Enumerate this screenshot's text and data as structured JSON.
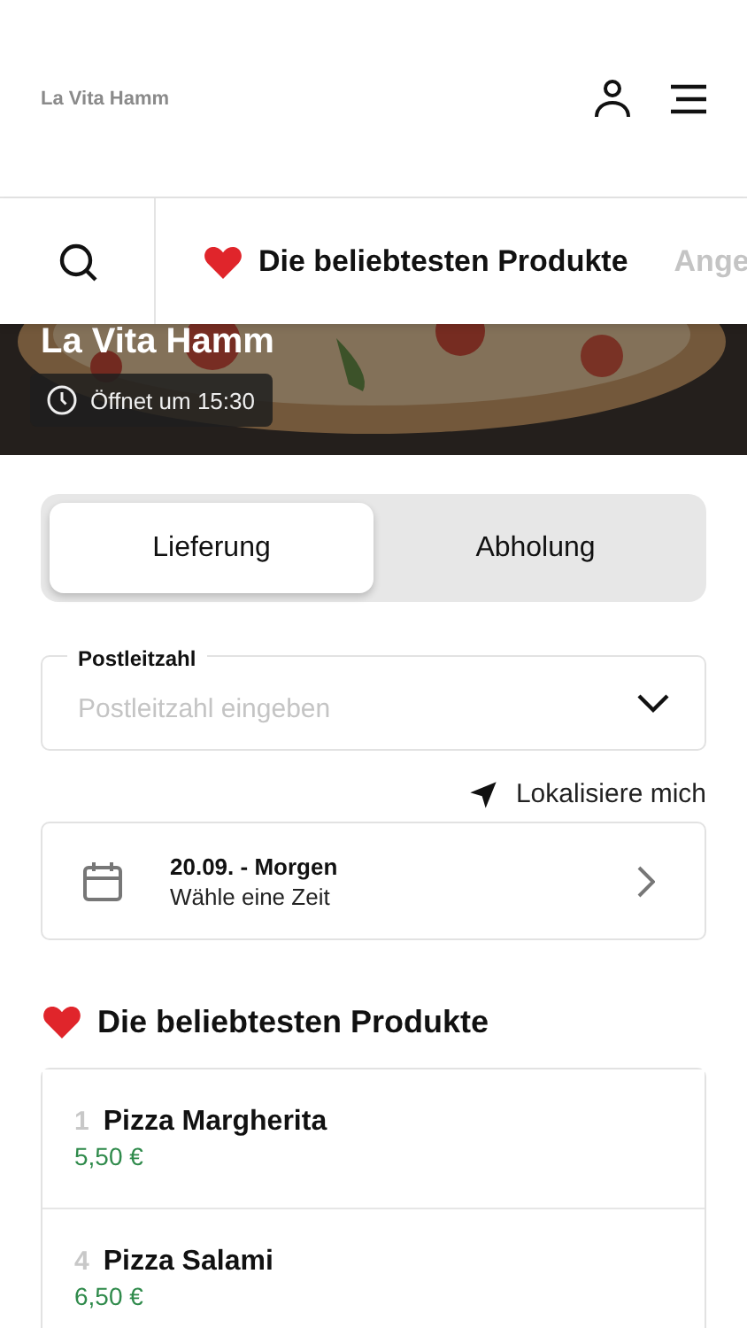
{
  "header": {
    "title": "La Vita Hamm"
  },
  "category_tabs": [
    {
      "label": "Die beliebtesten Produkte",
      "selected": true,
      "heart": true
    },
    {
      "label": "Ange",
      "selected": false,
      "heart": false
    }
  ],
  "hero": {
    "title": "La Vita Hamm",
    "status": "Öffnet um 15:30"
  },
  "order_modes": [
    {
      "label": "Lieferung",
      "selected": true
    },
    {
      "label": "Abholung",
      "selected": false
    }
  ],
  "postcode": {
    "label": "Postleitzahl",
    "placeholder": "Postleitzahl eingeben"
  },
  "locate": "Lokalisiere mich",
  "schedule": {
    "date": "20.09. - Morgen",
    "hint": "Wähle eine Zeit"
  },
  "section": {
    "title": "Die beliebtesten Produkte"
  },
  "products": [
    {
      "rank": "1",
      "name": "Pizza Margherita",
      "price": "5,50 €"
    },
    {
      "rank": "4",
      "name": "Pizza Salami",
      "price": "6,50 €"
    }
  ]
}
